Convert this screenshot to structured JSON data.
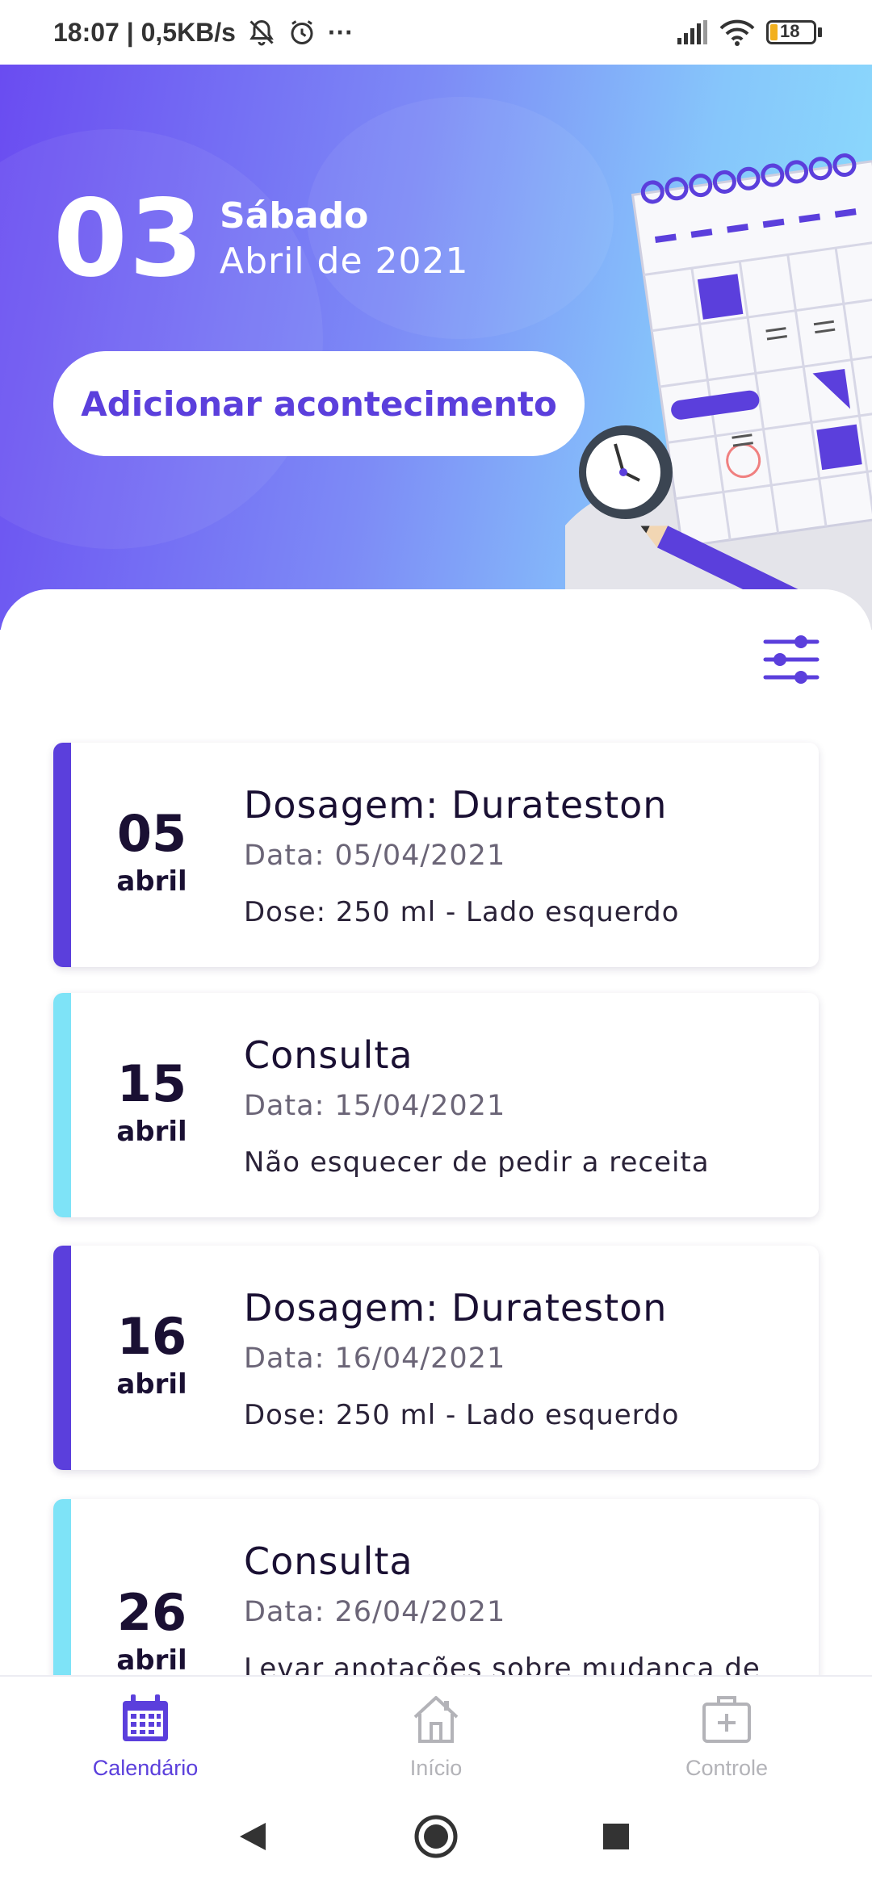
{
  "status_bar": {
    "time_speed": "18:07 | 0,5KB/s",
    "more": "···",
    "battery": "18"
  },
  "header": {
    "day": "03",
    "weekday": "Sábado",
    "month_year": "Abril de 2021",
    "add_button": "Adicionar acontecimento"
  },
  "events": [
    {
      "day": "05",
      "month": "abril",
      "title": "Dosagem: Durateston",
      "date": "Data: 05/04/2021",
      "description": "Dose: 250 ml - Lado esquerdo",
      "accent": "#5b3fdc"
    },
    {
      "day": "15",
      "month": "abril",
      "title": "Consulta",
      "date": "Data: 15/04/2021",
      "description": "Não esquecer de pedir a receita",
      "accent": "#7ee3f7"
    },
    {
      "day": "16",
      "month": "abril",
      "title": "Dosagem: Durateston",
      "date": "Data: 16/04/2021",
      "description": "Dose: 250 ml - Lado esquerdo",
      "accent": "#5b3fdc"
    },
    {
      "day": "26",
      "month": "abril",
      "title": "Consulta",
      "date": "Data: 26/04/2021",
      "description": "Levar anotações sobre mudança de",
      "accent": "#7ee3f7"
    }
  ],
  "bottom_nav": {
    "items": [
      {
        "label": "Calendário",
        "icon": "calendar-icon",
        "active": true
      },
      {
        "label": "Início",
        "icon": "home-icon",
        "active": false
      },
      {
        "label": "Controle",
        "icon": "medical-kit-icon",
        "active": false
      }
    ]
  },
  "colors": {
    "primary": "#5b3fdc",
    "accent_cyan": "#7ee3f7",
    "inactive": "#b3b3b8"
  }
}
